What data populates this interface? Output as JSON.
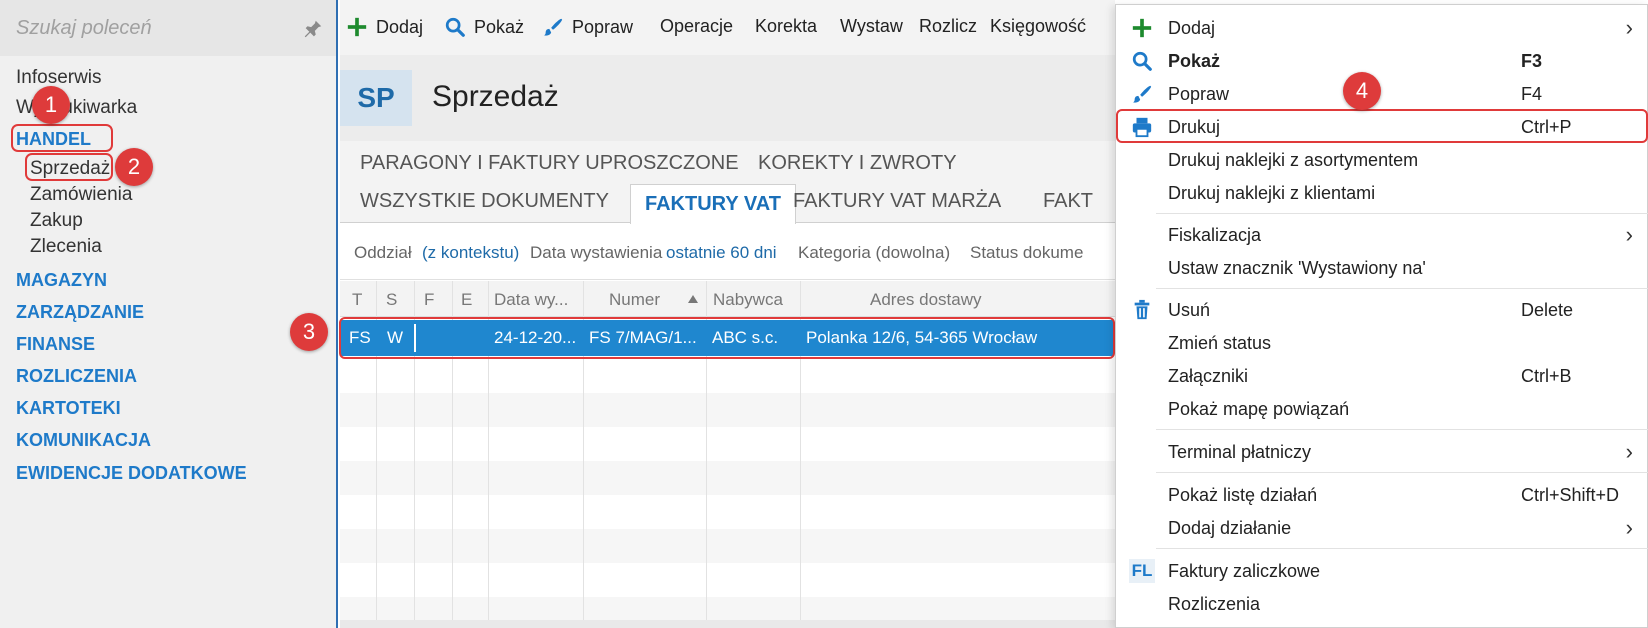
{
  "sidebar": {
    "search_placeholder": "Szukaj poleceń",
    "items": [
      {
        "label": "Infoserwis"
      },
      {
        "label": "Wyszukiwarka"
      },
      {
        "label": "HANDEL"
      },
      {
        "label": "Sprzedaż"
      },
      {
        "label": "Zamówienia"
      },
      {
        "label": "Zakup"
      },
      {
        "label": "Zlecenia"
      }
    ],
    "sections": [
      "MAGAZYN",
      "ZARZĄDZANIE",
      "FINANSE",
      "ROZLICZENIA",
      "KARTOTEKI",
      "KOMUNIKACJA",
      "EWIDENCJE DODATKOWE"
    ]
  },
  "badges": [
    "1",
    "2",
    "3",
    "4"
  ],
  "toolbar": {
    "items": [
      "Dodaj",
      "Pokaż",
      "Popraw",
      "Operacje",
      "Korekta",
      "Wystaw",
      "Rozlicz",
      "Księgowość"
    ]
  },
  "header": {
    "code": "SP",
    "title": "Sprzedaż"
  },
  "tabs": {
    "row1": [
      "PARAGONY I FAKTURY UPROSZCZONE",
      "KOREKTY I ZWROTY"
    ],
    "row2": [
      "WSZYSTKIE DOKUMENTY",
      "FAKTURY VAT",
      "FAKTURY VAT MARŻA",
      "FAKT"
    ]
  },
  "filters": {
    "oddzial_label": "Oddział",
    "oddzial_value": "(z kontekstu)",
    "data_label": "Data wystawienia",
    "data_value": "ostatnie 60 dni",
    "kategoria": "Kategoria (dowolna)",
    "status": "Status dokume"
  },
  "table": {
    "columns": [
      "T",
      "S",
      "F",
      "E",
      "Data wy...",
      "Numer",
      "Nabywca",
      "Adres dostawy"
    ],
    "rows": [
      {
        "T": "FS",
        "S": "W",
        "data": "24-12-20...",
        "numer": "FS 7/MAG/1...",
        "nabywca": "ABC s.c.",
        "adres": "Polanka  12/6, 54-365 Wrocław"
      }
    ]
  },
  "menu": {
    "items": [
      {
        "label": "Dodaj",
        "shortcut": "",
        "submenu": true
      },
      {
        "label": "Pokaż",
        "shortcut": "F3"
      },
      {
        "label": "Popraw",
        "shortcut": "F4"
      },
      {
        "label": "Drukuj",
        "shortcut": "Ctrl+P"
      },
      {
        "label": "Drukuj naklejki z asortymentem",
        "shortcut": ""
      },
      {
        "label": "Drukuj naklejki z klientami",
        "shortcut": ""
      },
      {
        "label": "Fiskalizacja",
        "shortcut": "",
        "submenu": true
      },
      {
        "label": "Ustaw znacznik 'Wystawiony na'",
        "shortcut": ""
      },
      {
        "label": "Usuń",
        "shortcut": "Delete"
      },
      {
        "label": "Zmień status",
        "shortcut": ""
      },
      {
        "label": "Załączniki",
        "shortcut": "Ctrl+B"
      },
      {
        "label": "Pokaż mapę powiązań",
        "shortcut": ""
      },
      {
        "label": "Terminal płatniczy",
        "shortcut": "",
        "submenu": true
      },
      {
        "label": "Pokaż listę działań",
        "shortcut": "Ctrl+Shift+D"
      },
      {
        "label": "Dodaj działanie",
        "shortcut": "",
        "submenu": true
      },
      {
        "label": "Faktury zaliczkowe",
        "shortcut": "",
        "icon_text": "FL"
      },
      {
        "label": "Rozliczenia",
        "shortcut": ""
      }
    ]
  },
  "colors": {
    "accent": "#1e7ac9",
    "selection": "#1f87cf",
    "highlight": "#e03a3a",
    "add_green": "#1e8a2e"
  }
}
